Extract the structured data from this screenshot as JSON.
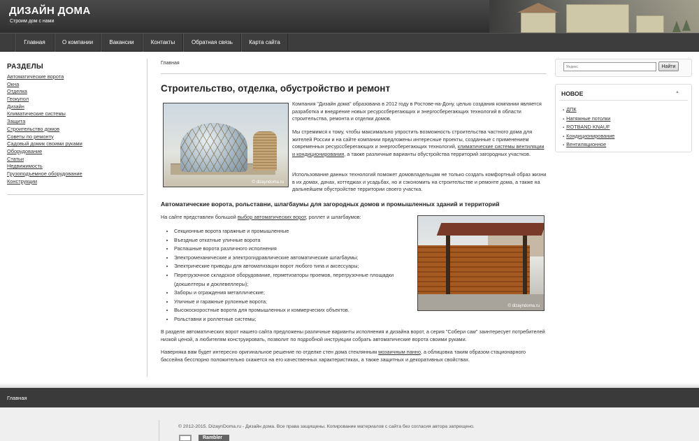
{
  "header": {
    "site_title": "ДИЗАЙН ДОМА",
    "slogan": "Строим дом с нами"
  },
  "nav": {
    "items": [
      {
        "label": "Главная"
      },
      {
        "label": "О компании"
      },
      {
        "label": "Вакансии"
      },
      {
        "label": "Контакты"
      },
      {
        "label": "Обратная связь"
      },
      {
        "label": "Карта сайта"
      }
    ]
  },
  "sidebar": {
    "title": "РАЗДЕЛЫ",
    "items": [
      "Автоматические ворота",
      "Окна",
      "Отделка",
      "Геокупол",
      "Дизайн",
      "Климатические системы",
      "Защита",
      "Строительство домов",
      "Советы по ремонту",
      "Садовый домик своими руками",
      "Оборудование",
      "Статьи",
      "Недвижимость",
      "Грузоподъемное оборудование",
      "Конструкции"
    ]
  },
  "main": {
    "breadcrumb": "Главная",
    "title": "Строительство, отделка, обустройство и ремонт",
    "image1_watermark": "© dizayndoma.ru",
    "p1": "Компания \"Дизайн дома\" образована в 2012 году в Ростове-на-Дону, целью создания компании является разработка и внедрение новых ресурссберегающих и энергосберегающих технологий в области строительства, ремонта и отделки домов.",
    "p2_a": "Мы стремимся к тому, чтобы максимально упростить возможность строительства частного дома для жителей России и на сайте компании предложены интересные проекты, созданные с применением современных ресурссберегающих и энергосберегающих технологий, ",
    "p2_link": "климатические системы вентиляции и кондиционирования",
    "p2_b": ", а также различные варианты обустройства территорий загородных участков.",
    "p3": "Использование данных технологий поможет домовладельцам не только создать комфортный образ жизни в их домах, дачах, коттеджах и усадьбах, но и сэкономить на строительстве и ремонте дома, а также на дальнейшем обустройстве территории своего участка.",
    "subtitle": "Автоматические ворота, рольставни, шлагбаумы для загородных домов и промышленных зданий и территорий",
    "intro_a": "На сайте представлен большой ",
    "intro_link": "выбор автоматических ворот",
    "intro_b": ", роллет и шлагбаумов:",
    "image2_watermark": "© dizayndoma.ru",
    "bullets": [
      "Секционные ворота гаражные и промышленные",
      "Въездные откатные уличные ворота",
      "Распашные ворота различного исполнения",
      "Электромеханические и электрогидравлические автоматические шлагбаумы;",
      "Электрические приводы для автоматизации ворот любого типа и аксессуары;",
      "Перегрузочное складское оборудование, герметизаторы проемов, перегрузочные площадки (докшелтеры и доклевеллеры);",
      "Заборы и ограждения металлические;",
      "Уличные и гаражные рулонные ворота;",
      "Высокоскоростные ворота для промышленных и коммерческих объектов.",
      "Рольставни и роллетные системы;"
    ],
    "p4": "В разделе автоматических ворот нашего сайта предложены различные варианты исполнения и дизайна ворот, а серия \"Собери сам\" заинтересует потребителей низкой ценой, а любителям конструировать, позволит по подробной инструкции собрать автоматические ворота своими руками.",
    "p5_a": "Наверняка вам будет интересно оригинальное решение по отделке стен дома стеклянным ",
    "p5_link": "мозаичным панно",
    "p5_b": ", а облицовка таким образом стационарного бассейна бесспорно положительно скажется на его качественных характеристиках, а также защитных и декоративных свойствах."
  },
  "search": {
    "placeholder": "Яндекс",
    "button": "Найти"
  },
  "news": {
    "title": "НОВОЕ",
    "items": [
      "ДПК",
      "Натяжные потолки",
      "ROTBAND KNAUF",
      "Кондиционирование",
      "Вентиляционное"
    ]
  },
  "footer": {
    "link": "Главная",
    "copyright": "© 2012-2015. DizaynDoma.ru - Дизайн дома. Все права защищены. Копирование материалов с сайта без согласия автора запрещено.",
    "counter_label": "Rambler"
  }
}
